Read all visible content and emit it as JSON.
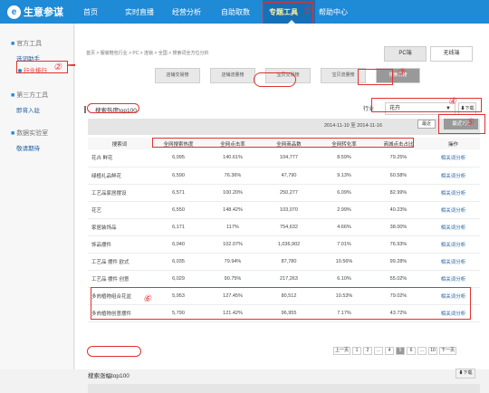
{
  "brand": {
    "name": "生意参谋"
  },
  "nav": {
    "items": [
      "首页",
      "实时直播",
      "经营分析",
      "自助取数",
      "专题工具",
      "帮助中心"
    ]
  },
  "sidebar": {
    "official_tools_title": "官方工具",
    "official_links": [
      "选词助手",
      "行业排行"
    ],
    "third_party_title": "第三方工具",
    "third_party_link": "即将入驻",
    "data_lab_title": "数据实验室",
    "data_lab_link": "敬请期待"
  },
  "main": {
    "breadcrumb": "首页 > 服装鞋包行业 > PC > 连锁 > 全国 > 搜索词全方位分析",
    "device_tabs": [
      "PC端",
      "无线端"
    ],
    "tabs": [
      "店铺交易榜",
      "店铺流量榜",
      "宝贝交易榜",
      "宝贝流量榜",
      "搜索词榜"
    ],
    "section_title": "搜索热度top100",
    "filter_label": "行业",
    "filter_value": "花卉",
    "download_label": "下载",
    "date_range": "2014-11-10 至 2014-11-16",
    "date_button": "最近",
    "filter_button": "最近7天",
    "table": {
      "headers": [
        "搜索词",
        "全网搜索热度",
        "全网点击率",
        "全网商品数",
        "全网转化率",
        "商城点击占比",
        "操作"
      ],
      "rows": [
        [
          "花卉 鲜花",
          "6,095",
          "140.61%",
          "104,777",
          "8.59%",
          "79.25%",
          "相关词分析"
        ],
        [
          "绿植礼品鲜花",
          "6,590",
          "76.36%",
          "47,790",
          "9.13%",
          "60.58%",
          "相关词分析"
        ],
        [
          "工艺品家居摆设",
          "6,571",
          "100.20%",
          "250,277",
          "6.09%",
          "82.99%",
          "相关词分析"
        ],
        [
          "花艺",
          "6,550",
          "148.42%",
          "103,070",
          "2.99%",
          "40.23%",
          "相关词分析"
        ],
        [
          "家居装饰品",
          "6,171",
          "117%",
          "754,632",
          "4.66%",
          "38.00%",
          "相关词分析"
        ],
        [
          "饰品摆件",
          "6,040",
          "102.07%",
          "1,036,902",
          "7.01%",
          "76.93%",
          "相关词分析"
        ],
        [
          "工艺品 摆件 欧式",
          "6,035",
          "79.94%",
          "87,780",
          "10.56%",
          "99.28%",
          "相关词分析"
        ],
        [
          "工艺品 摆件 创意",
          "6,029",
          "90.75%",
          "217,263",
          "6.10%",
          "55.02%",
          "相关词分析"
        ],
        [
          "多肉植物组合花盆",
          "5,953",
          "127.45%",
          "80,512",
          "10.53%",
          "79.02%",
          "相关词分析"
        ],
        [
          "多肉植物创意摆件",
          "5,790",
          "121.42%",
          "96,955",
          "7.17%",
          "43.72%",
          "相关词分析"
        ]
      ]
    },
    "pagination": [
      "上一页",
      "1",
      "2",
      "...",
      "4",
      "5",
      "6",
      "...",
      "10",
      "下一页"
    ],
    "lower_section_title": "搜索涨幅top100",
    "lower_download": "下载"
  },
  "annotations": [
    "1",
    "2",
    "3",
    "4",
    "5",
    "6"
  ],
  "colors": {
    "topbar": "#1f8ad6",
    "annotation": "#e03131",
    "link": "#1f5f9f"
  }
}
